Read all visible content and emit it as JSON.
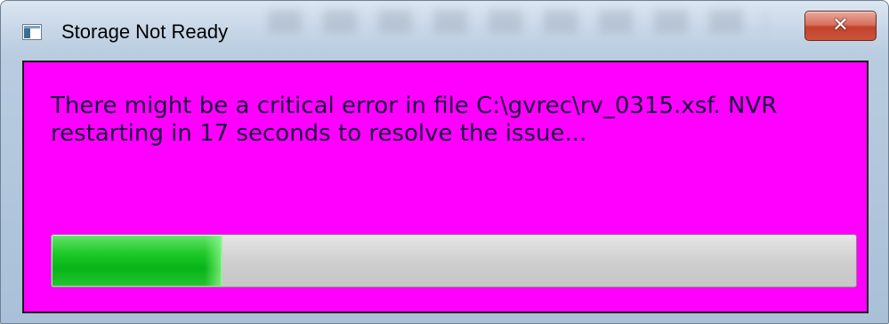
{
  "window": {
    "title": "Storage Not Ready",
    "close_symbol": "✕",
    "app_icon": "window-app-icon",
    "close_icon": "close-icon"
  },
  "dialog": {
    "message": "There might be a critical error in file C:\\gvrec\\rv_0315.xsf. NVR\nrestarting in 17 seconds to resolve the issue...",
    "progress_fraction": 0.21
  },
  "colors": {
    "dialog_background": "#ff00ff",
    "message_text": "#1a0a40",
    "progress_fill": "#1ec928",
    "progress_track": "#cfcfcf",
    "close_button": "#c3422b"
  }
}
